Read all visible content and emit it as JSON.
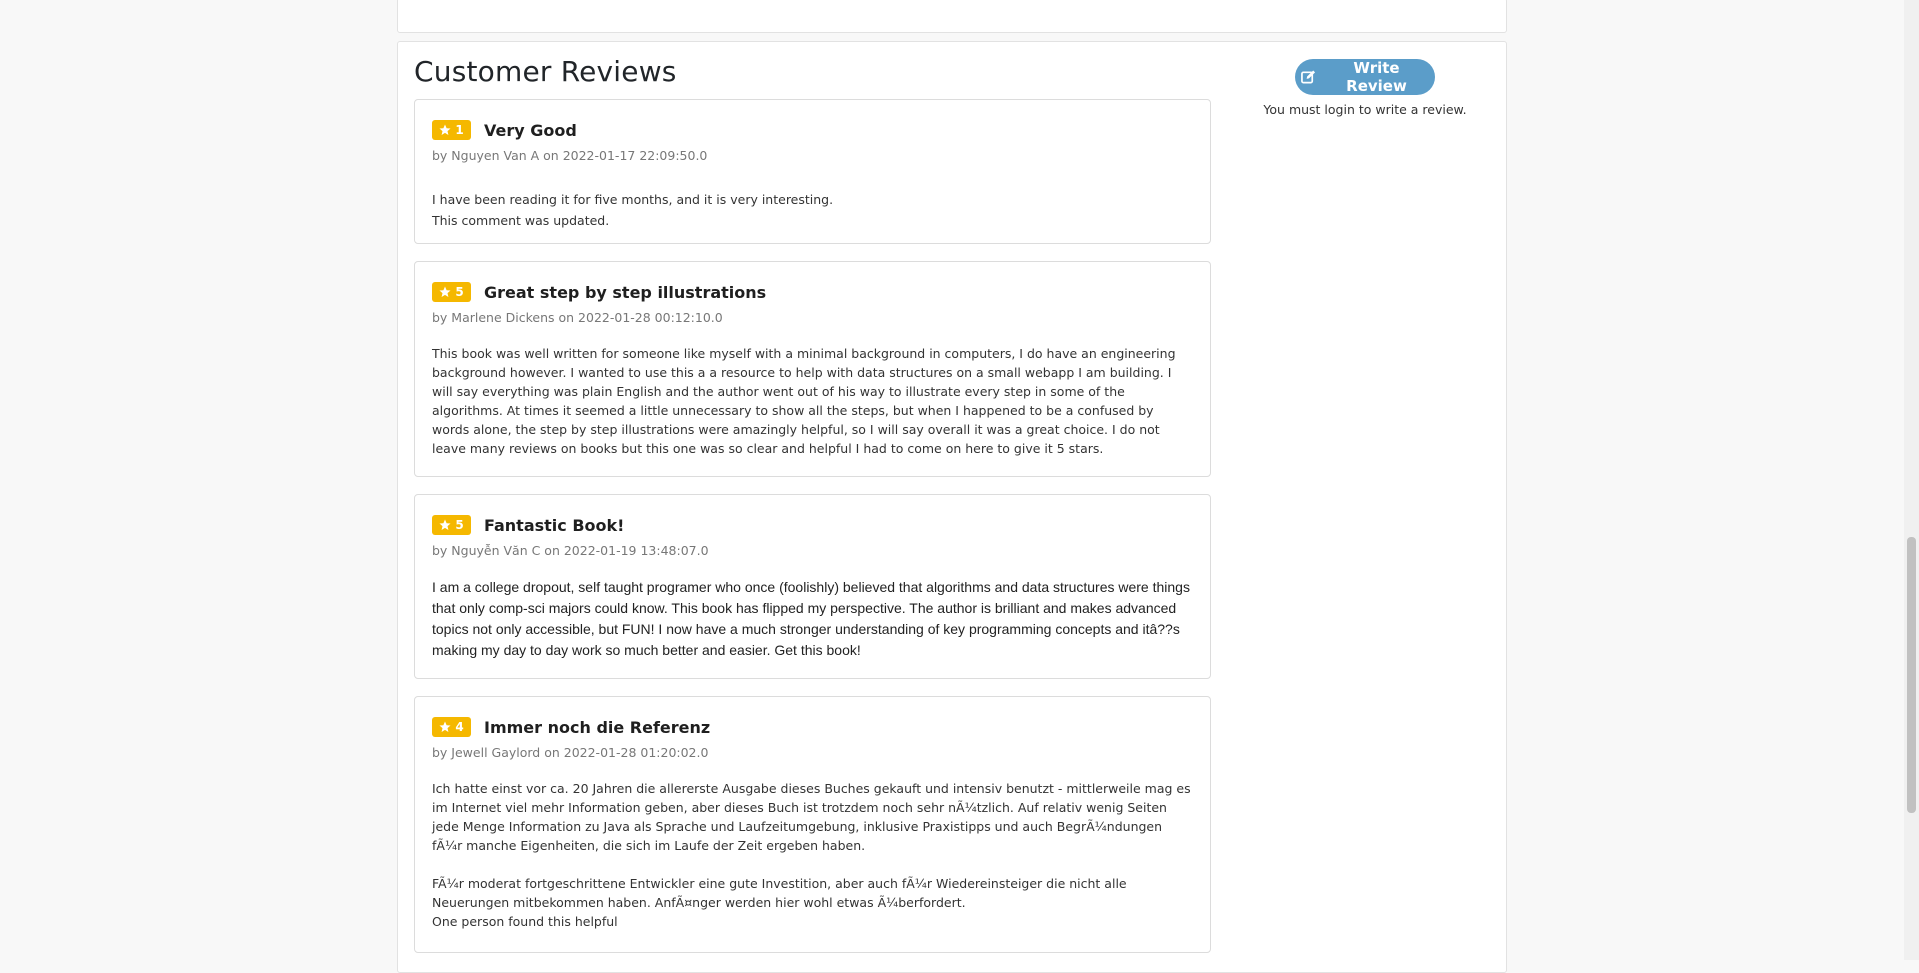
{
  "reviews_section": {
    "title": "Customer Reviews",
    "write_review_label": "Write Review",
    "login_note": "You must login to write a review."
  },
  "colors": {
    "badge": "#f5b800",
    "button": "#5b9dc9"
  },
  "reviews": [
    {
      "rating": "1",
      "title": "Very Good",
      "meta": "by Nguyen Van A on 2022-01-17 22:09:50.0",
      "paragraphs": [
        "I have been reading it for five months, and it is very interesting.",
        "This comment was updated."
      ]
    },
    {
      "rating": "5",
      "title": "Great step by step illustrations",
      "meta": "by Marlene Dickens on 2022-01-28 00:12:10.0",
      "paragraphs": [
        "This book was well written for someone like myself with a minimal background in computers, I do have an engineering background however. I wanted to use this a a resource to help with data structures on a small webapp I am building. I will say everything was plain English and the author went out of his way to illustrate every step in some of the algorithms. At times it seemed a little unnecessary to show all the steps, but when I happened to be a confused by words alone, the step by step illustrations were amazingly helpful, so I will say overall it was a great choice. I do not leave many reviews on books but this one was so clear and helpful I had to come on here to give it 5 stars."
      ]
    },
    {
      "rating": "5",
      "title": "Fantastic Book!",
      "meta": "by Nguyễn Văn C on 2022-01-19 13:48:07.0",
      "paragraphs": [
        "I am a college dropout, self taught programer who once (foolishly) believed that algorithms and data structures were things that only comp-sci majors could know. This book has flipped my perspective. The author is brilliant and makes advanced topics not only accessible, but FUN! I now have a much stronger understanding of key programming concepts and itâ??s making my day to day work so much better and easier. Get this book!"
      ]
    },
    {
      "rating": "4",
      "title": "Immer noch die Referenz",
      "meta": "by Jewell Gaylord on 2022-01-28 01:20:02.0",
      "paragraphs": [
        "Ich hatte einst vor ca. 20 Jahren die allererste Ausgabe dieses Buches gekauft und intensiv benutzt - mittlerweile mag es im Internet viel mehr Information geben, aber dieses Buch ist trotzdem noch sehr nÃ¼tzlich. Auf relativ wenig Seiten jede Menge Information zu Java als Sprache und Laufzeitumgebung, inklusive Praxistipps und auch BegrÃ¼ndungen fÃ¼r manche Eigenheiten, die sich im Laufe der Zeit ergeben haben.",
        "FÃ¼r moderat fortgeschrittene Entwickler eine gute Investition, aber auch fÃ¼r Wiedereinsteiger die nicht alle Neuerungen mitbekommen haben. AnfÃ¤nger werden hier wohl etwas Ã¼berfordert.",
        "One person found this helpful"
      ]
    }
  ]
}
